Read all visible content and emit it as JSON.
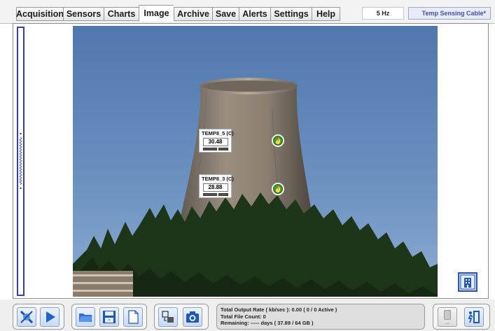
{
  "tabs": [
    {
      "label": "Acquisition"
    },
    {
      "label": "Sensors"
    },
    {
      "label": "Charts"
    },
    {
      "label": "Image",
      "active": true
    },
    {
      "label": "Archive"
    },
    {
      "label": "Save"
    },
    {
      "label": "Alerts"
    },
    {
      "label": "Settings"
    },
    {
      "label": "Help"
    }
  ],
  "header": {
    "sample_rate": "5 Hz",
    "config_name": "Temp Sensing Cable*"
  },
  "sensors": [
    {
      "label": "TEMP8_5 (C)",
      "value": "30.48",
      "level": 0.55
    },
    {
      "label": "TEMP8_3 (C)",
      "value": "28.88",
      "level": 0.55
    }
  ],
  "status": {
    "output_rate": "Total Output Rate ( kb/sec ): 0.00 ( 0 / 0 Active )",
    "file_count": "Total File Count: 0",
    "remaining": "Remaining: ----- days ( 37.89 / 64 GB )"
  },
  "toolbar": {
    "icons": [
      "connect-icon",
      "play-icon",
      "open-folder-icon",
      "save-disk-icon",
      "new-document-icon",
      "transfer-icon",
      "camera-icon",
      "storage-icon",
      "exit-icon"
    ],
    "storage_label": "---"
  },
  "colors": {
    "accent": "#3540a8",
    "sky": "#5d83b6",
    "tower": "#8e8173",
    "forest": "#1f3a1c"
  }
}
